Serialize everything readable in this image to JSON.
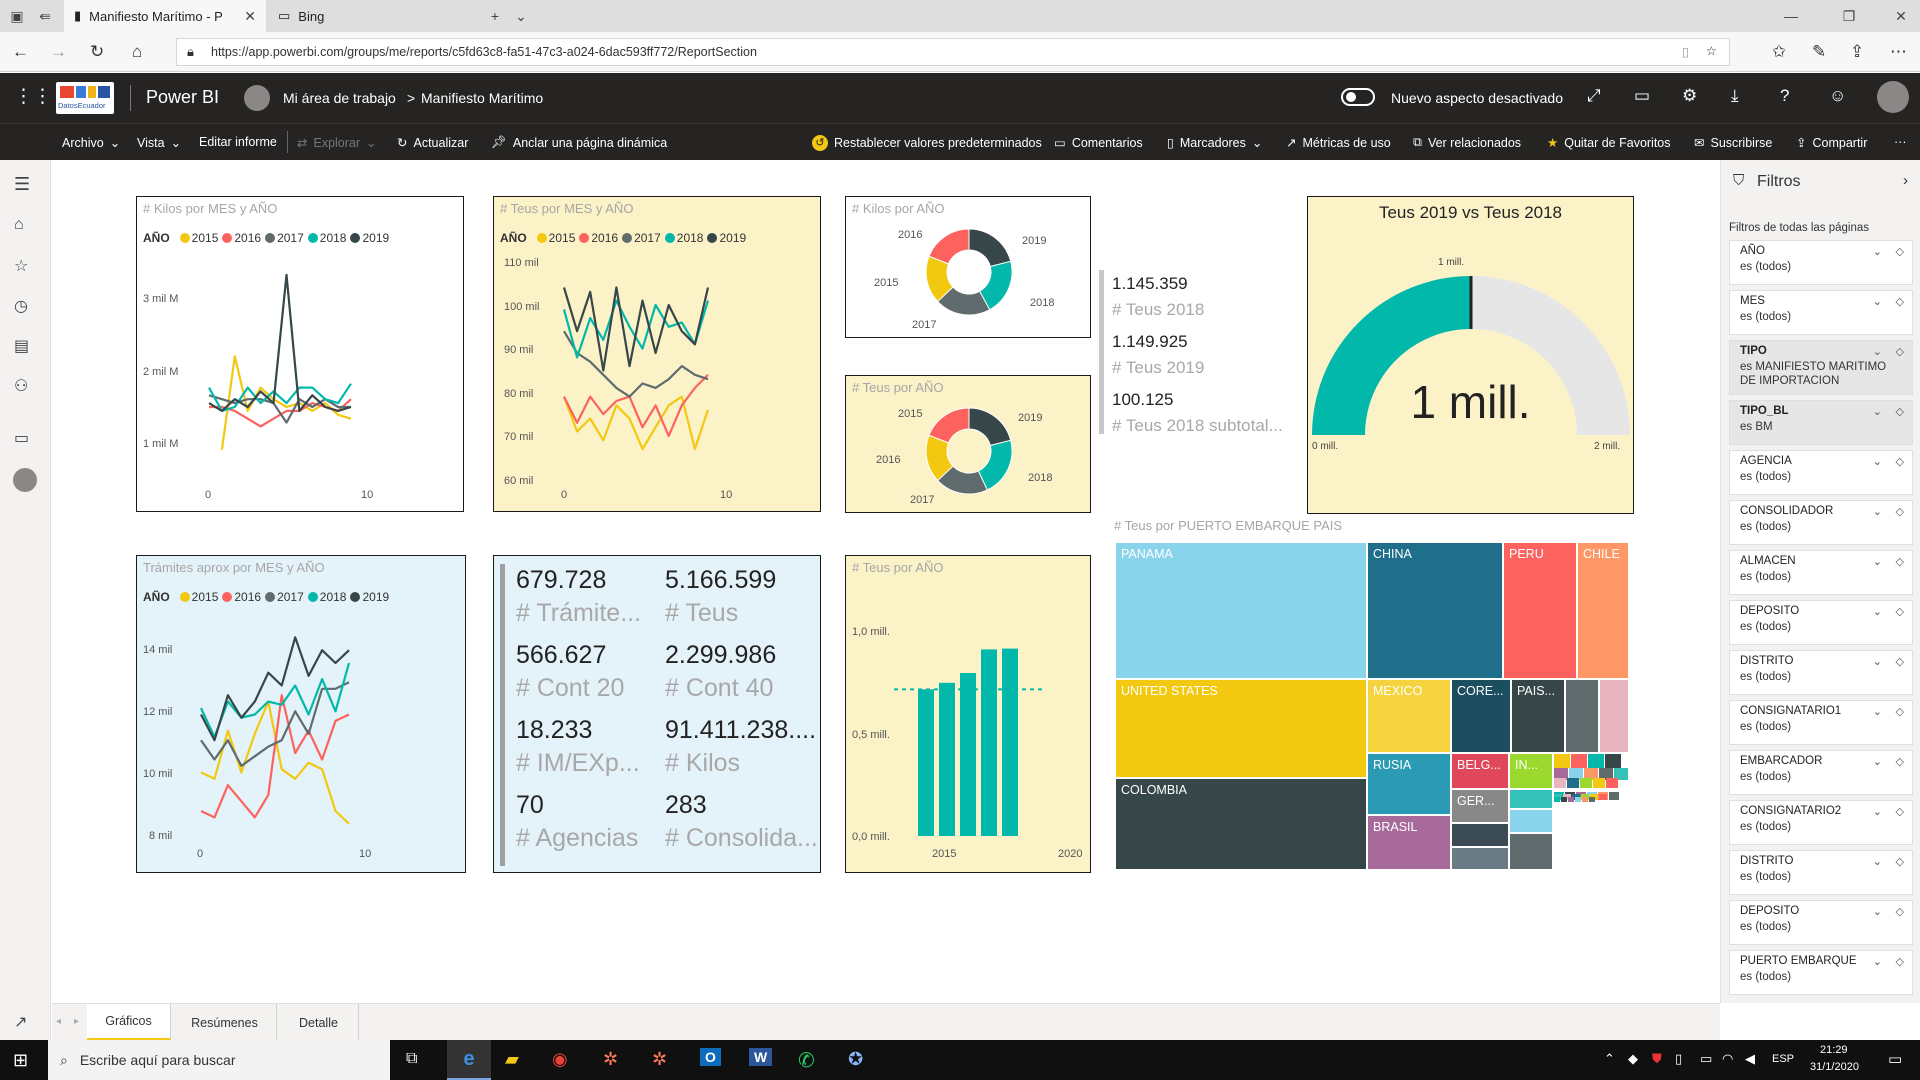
{
  "browser": {
    "tab_active": "Manifiesto Marítimo - P",
    "tab_other": "Bing",
    "url": "https://app.powerbi.com/groups/me/reports/c5fd63c8-fa51-47c3-a024-6dac593ff772/ReportSection"
  },
  "header": {
    "logo_text": "DatosEcuador",
    "app_name": "Power BI",
    "workspace": "Mi área de trabajo",
    "separator": ">",
    "report": "Manifiesto Marítimo",
    "new_look_label": "Nuevo aspecto desactivado"
  },
  "ribbon": {
    "archivo": "Archivo",
    "vista": "Vista",
    "editar": "Editar informe",
    "explorar": "Explorar",
    "actualizar": "Actualizar",
    "anclar": "Anclar una página dinámica",
    "restablecer": "Restablecer valores predeterminados",
    "comentarios": "Comentarios",
    "marcadores": "Marcadores",
    "metricas": "Métricas de uso",
    "relacionados": "Ver relacionados",
    "favoritos": "Quitar de Favoritos",
    "suscribirse": "Suscribirse",
    "compartir": "Compartir",
    "more": "···"
  },
  "colors": {
    "y2015": "#F2C811",
    "y2016": "#FD625E",
    "y2017": "#5F6B6D",
    "y2018": "#01B8AA",
    "y2019": "#374649",
    "yellow_bg": "#FCF2C8",
    "blue_bg": "#E4F3F9"
  },
  "legend": {
    "prefix": "AÑO",
    "years": [
      "2015",
      "2016",
      "2017",
      "2018",
      "2019"
    ]
  },
  "kilos_chart": {
    "title": "# Kilos por MES y AÑO",
    "yticks": [
      "3 mil M",
      "2 mil M",
      "1 mil M"
    ],
    "xticks": [
      "0",
      "10"
    ]
  },
  "teus_chart": {
    "title": "# Teus por MES y AÑO",
    "yticks": [
      "110 mil",
      "100 mil",
      "90 mil",
      "80 mil",
      "70 mil",
      "60 mil"
    ],
    "xticks": [
      "0",
      "10"
    ]
  },
  "tramites_chart": {
    "title": "Trámites aprox por MES y AÑO",
    "yticks": [
      "14 mil",
      "12 mil",
      "10 mil",
      "8 mil"
    ],
    "xticks": [
      "0",
      "10"
    ]
  },
  "donut_kilos": {
    "title": "# Kilos por AÑO",
    "labels": [
      "2016",
      "2019",
      "2015",
      "2018",
      "2017"
    ]
  },
  "donut_teus": {
    "title": "# Teus por AÑO",
    "labels": [
      "2015",
      "2019",
      "2016",
      "2018",
      "2017"
    ]
  },
  "kpi_side": [
    {
      "value": "1.145.359",
      "label": "# Teus 2018"
    },
    {
      "value": "1.149.925",
      "label": "# Teus 2019"
    },
    {
      "value": "100.125",
      "label": "# Teus 2018 subtotal..."
    }
  ],
  "gauge": {
    "title": "Teus 2019 vs Teus 2018",
    "value_label": "1 mill.",
    "min_label": "0 mill.",
    "max_label": "2 mill.",
    "target_label": "1 mill.",
    "fraction": 0.5
  },
  "kpi_grid": [
    {
      "value": "679.728",
      "label": "# Trámite..."
    },
    {
      "value": "5.166.599",
      "label": "# Teus"
    },
    {
      "value": "566.627",
      "label": "# Cont 20"
    },
    {
      "value": "2.299.986",
      "label": "# Cont 40"
    },
    {
      "value": "18.233",
      "label": "# IM/EXp..."
    },
    {
      "value": "91.411.238....",
      "label": "# Kilos"
    },
    {
      "value": "70",
      "label": "# Agencias"
    },
    {
      "value": "283",
      "label": "# Consolida..."
    }
  ],
  "teus_bar": {
    "title": "# Teus por AÑO",
    "yticks": [
      "1,0 mill.",
      "0,5 mill.",
      "0,0 mill."
    ],
    "xticks": [
      "2015",
      "2020"
    ]
  },
  "treemap": {
    "title": "# Teus por PUERTO EMBARQUE PAIS",
    "labels": {
      "panama": "PANAMA",
      "china": "CHINA",
      "peru": "PERU",
      "chile": "CHILE",
      "us": "UNITED STATES",
      "mexico": "MEXICO",
      "korea": "CORE...",
      "paises": "PAIS...",
      "colombia": "COLOMBIA",
      "rusia": "RUSIA",
      "belg": "BELG...",
      "in": "IN...",
      "ger": "GER...",
      "brasil": "BRASIL"
    }
  },
  "chart_data": [
    {
      "type": "line",
      "title": "# Kilos por MES y AÑO",
      "x": [
        1,
        2,
        3,
        4,
        5,
        6,
        7,
        8,
        9,
        10,
        11,
        12
      ],
      "ylim": [
        0.6,
        3.3
      ],
      "ylabel": "mil M",
      "series": [
        {
          "name": "2015",
          "values": [
            null,
            0.95,
            2.15,
            1.45,
            1.75,
            1.6,
            1.5,
            1.55,
            1.45,
            1.55,
            1.4,
            1.35
          ]
        },
        {
          "name": "2016",
          "values": [
            1.5,
            1.5,
            1.45,
            1.35,
            1.25,
            1.35,
            1.45,
            1.45,
            1.55,
            1.5,
            1.45,
            1.6
          ]
        },
        {
          "name": "2017",
          "values": [
            1.65,
            1.6,
            1.55,
            1.6,
            1.6,
            1.55,
            1.3,
            1.6,
            1.5,
            1.6,
            1.5,
            1.5
          ]
        },
        {
          "name": "2018",
          "values": [
            1.75,
            1.45,
            1.5,
            1.75,
            1.55,
            1.7,
            1.55,
            1.75,
            1.75,
            1.6,
            1.55,
            1.8
          ]
        },
        {
          "name": "2019",
          "values": [
            1.55,
            1.45,
            1.6,
            1.5,
            1.7,
            1.55,
            3.2,
            1.45,
            1.65,
            1.5,
            1.45,
            1.5
          ]
        }
      ]
    },
    {
      "type": "line",
      "title": "# Teus por MES y AÑO",
      "x": [
        1,
        2,
        3,
        4,
        5,
        6,
        7,
        8,
        9,
        10,
        11,
        12
      ],
      "ylim": [
        57,
        112
      ],
      "ylabel": "mil",
      "series": [
        {
          "name": "2015",
          "values": [
            80,
            72,
            75,
            70,
            78,
            75,
            68,
            73,
            78,
            80,
            68,
            77
          ]
        },
        {
          "name": "2016",
          "values": [
            80,
            74,
            80,
            76,
            79,
            80,
            73,
            78,
            71,
            78,
            82,
            85
          ]
        },
        {
          "name": "2017",
          "values": [
            95,
            90,
            88,
            85,
            82,
            80,
            83,
            82,
            84,
            87,
            85,
            84
          ]
        },
        {
          "name": "2018",
          "values": [
            100,
            89,
            98,
            93,
            102,
            96,
            91,
            101,
            96,
            97,
            92,
            102
          ]
        },
        {
          "name": "2019",
          "values": [
            105,
            95,
            104,
            86,
            105,
            87,
            102,
            90,
            101,
            95,
            92,
            105
          ]
        }
      ]
    },
    {
      "type": "line",
      "title": "Trámites aprox por MES y AÑO",
      "x": [
        1,
        2,
        3,
        4,
        5,
        6,
        7,
        8,
        9,
        10,
        11,
        12
      ],
      "ylim": [
        7.6,
        15
      ],
      "ylabel": "mil",
      "series": [
        {
          "name": "2015",
          "values": [
            10.2,
            10.0,
            11.5,
            10.2,
            11.4,
            12.4,
            10.3,
            10.0,
            10.5,
            10.3,
            9.0,
            8.6
          ]
        },
        {
          "name": "2016",
          "values": [
            9.0,
            8.8,
            9.8,
            9.3,
            8.8,
            9.5,
            12.6,
            10.8,
            11.5,
            10.6,
            11.8,
            12.0
          ]
        },
        {
          "name": "2017",
          "values": [
            11.2,
            10.6,
            11.2,
            10.4,
            10.7,
            11.0,
            11.2,
            12.1,
            11.4,
            12.8,
            12.8,
            13.0
          ]
        },
        {
          "name": "2018",
          "values": [
            12.2,
            11.3,
            12.4,
            11.9,
            12.0,
            12.4,
            12.3,
            12.9,
            12.0,
            13.1,
            12.1,
            13.6
          ]
        },
        {
          "name": "2019",
          "values": [
            12.0,
            11.2,
            12.6,
            11.9,
            12.4,
            13.3,
            12.9,
            14.4,
            13.2,
            14.0,
            13.6,
            14.0
          ]
        }
      ]
    },
    {
      "type": "pie",
      "title": "# Kilos por AÑO",
      "categories": [
        "2015",
        "2016",
        "2017",
        "2018",
        "2019"
      ],
      "values": [
        18,
        19,
        21,
        21,
        21
      ]
    },
    {
      "type": "pie",
      "title": "# Teus por AÑO",
      "categories": [
        "2015",
        "2016",
        "2017",
        "2018",
        "2019"
      ],
      "values": [
        18,
        19,
        20,
        22,
        21
      ]
    },
    {
      "type": "bar",
      "title": "# Teus por AÑO",
      "categories": [
        "2015",
        "2016",
        "2017",
        "2018",
        "2019"
      ],
      "values": [
        0.9,
        0.94,
        1.0,
        1.145,
        1.15
      ],
      "ylim": [
        0,
        1.35
      ],
      "reference_line": 0.9
    },
    {
      "type": "table",
      "title": "# Teus por PUERTO EMBARQUE PAIS",
      "categories": [
        "PANAMA",
        "CHINA",
        "PERU",
        "CHILE",
        "UNITED STATES",
        "MEXICO",
        "CORE...",
        "PAIS...",
        "COLOMBIA",
        "RUSIA",
        "BELG...",
        "IN...",
        "GER...",
        "BRASIL"
      ]
    }
  ],
  "filters": {
    "title": "Filtros",
    "section": "Filtros de todas las páginas",
    "items": [
      {
        "name": "AÑO",
        "value": "es (todos)",
        "active": false
      },
      {
        "name": "MES",
        "value": "es (todos)",
        "active": false
      },
      {
        "name": "TIPO",
        "value": "es MANIFIESTO MARITIMO DE IMPORTACION",
        "active": true
      },
      {
        "name": "TIPO_BL",
        "value": "es BM",
        "active": true
      },
      {
        "name": "AGENCIA",
        "value": "es (todos)",
        "active": false
      },
      {
        "name": "CONSOLIDADOR",
        "value": "es (todos)",
        "active": false
      },
      {
        "name": "ALMACEN",
        "value": "es (todos)",
        "active": false
      },
      {
        "name": "DEPOSITO",
        "value": "es (todos)",
        "active": false
      },
      {
        "name": "DISTRITO",
        "value": "es (todos)",
        "active": false
      },
      {
        "name": "CONSIGNATARIO1",
        "value": "es (todos)",
        "active": false
      },
      {
        "name": "EMBARCADOR",
        "value": "es (todos)",
        "active": false
      },
      {
        "name": "CONSIGNATARIO2",
        "value": "es (todos)",
        "active": false
      },
      {
        "name": "DISTRITO",
        "value": "es (todos)",
        "active": false
      },
      {
        "name": "DEPOSITO",
        "value": "es (todos)",
        "active": false
      },
      {
        "name": "PUERTO EMBARQUE",
        "value": "es (todos)",
        "active": false
      }
    ]
  },
  "pages": {
    "tab1": "Gráficos",
    "tab2": "Resúmenes",
    "tab3": "Detalle"
  },
  "taskbar": {
    "search_placeholder": "Escribe aquí para buscar",
    "lang": "ESP",
    "time": "21:29",
    "date": "31/1/2020"
  }
}
